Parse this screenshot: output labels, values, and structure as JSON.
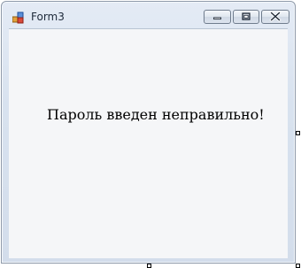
{
  "window": {
    "title": "Form3"
  },
  "icons": {
    "app": "form-app-icon",
    "minimize": "minimize-icon",
    "maximize": "maximize-icon",
    "close": "close-icon"
  },
  "content": {
    "message": "Пароль введен неправильно!"
  },
  "colors": {
    "titlebar": "#d8e2ef",
    "client_background": "#f5f6f8",
    "message_text": "#000000"
  }
}
